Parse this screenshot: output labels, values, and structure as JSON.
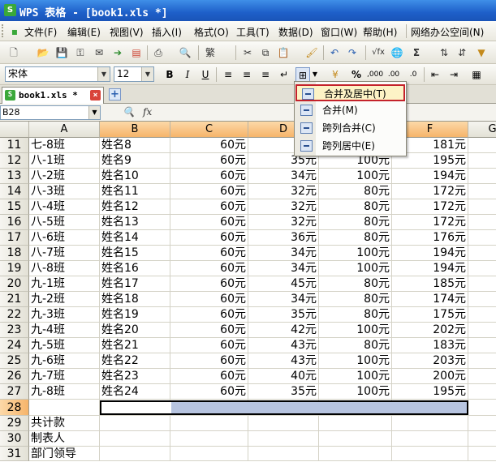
{
  "window": {
    "title": "WPS 表格 - [book1.xls *]",
    "logo": "S"
  },
  "menu": [
    "文件(F)",
    "编辑(E)",
    "视图(V)",
    "插入(I)",
    "格式(O)",
    "工具(T)",
    "数据(D)",
    "窗口(W)",
    "帮助(H)",
    "网络办公空间(N)"
  ],
  "format_toolbar": {
    "font_name": "宋体",
    "font_size": "12",
    "bold": "B",
    "italic": "I",
    "underline": "U",
    "percent": "%"
  },
  "tabs": [
    {
      "label": "book1.xls *",
      "close": "×"
    }
  ],
  "new_tab": "+",
  "formula_bar": {
    "cell_ref": "B28",
    "value": ""
  },
  "columns": [
    "A",
    "B",
    "C",
    "D",
    "E",
    "F",
    "G"
  ],
  "rows": [
    {
      "n": "11",
      "a": "七-8班",
      "b": "姓名8",
      "c": "60元",
      "d": "4",
      "e": "",
      "f": "181元"
    },
    {
      "n": "12",
      "a": "八-1班",
      "b": "姓名9",
      "c": "60元",
      "d": "35元",
      "e": "100元",
      "f": "195元"
    },
    {
      "n": "13",
      "a": "八-2班",
      "b": "姓名10",
      "c": "60元",
      "d": "34元",
      "e": "100元",
      "f": "194元"
    },
    {
      "n": "14",
      "a": "八-3班",
      "b": "姓名11",
      "c": "60元",
      "d": "32元",
      "e": "80元",
      "f": "172元"
    },
    {
      "n": "15",
      "a": "八-4班",
      "b": "姓名12",
      "c": "60元",
      "d": "32元",
      "e": "80元",
      "f": "172元"
    },
    {
      "n": "16",
      "a": "八-5班",
      "b": "姓名13",
      "c": "60元",
      "d": "32元",
      "e": "80元",
      "f": "172元"
    },
    {
      "n": "17",
      "a": "八-6班",
      "b": "姓名14",
      "c": "60元",
      "d": "36元",
      "e": "80元",
      "f": "176元"
    },
    {
      "n": "18",
      "a": "八-7班",
      "b": "姓名15",
      "c": "60元",
      "d": "34元",
      "e": "100元",
      "f": "194元"
    },
    {
      "n": "19",
      "a": "八-8班",
      "b": "姓名16",
      "c": "60元",
      "d": "34元",
      "e": "100元",
      "f": "194元"
    },
    {
      "n": "20",
      "a": "九-1班",
      "b": "姓名17",
      "c": "60元",
      "d": "45元",
      "e": "80元",
      "f": "185元"
    },
    {
      "n": "21",
      "a": "九-2班",
      "b": "姓名18",
      "c": "60元",
      "d": "34元",
      "e": "80元",
      "f": "174元"
    },
    {
      "n": "22",
      "a": "九-3班",
      "b": "姓名19",
      "c": "60元",
      "d": "35元",
      "e": "80元",
      "f": "175元"
    },
    {
      "n": "23",
      "a": "九-4班",
      "b": "姓名20",
      "c": "60元",
      "d": "42元",
      "e": "100元",
      "f": "202元"
    },
    {
      "n": "24",
      "a": "九-5班",
      "b": "姓名21",
      "c": "60元",
      "d": "43元",
      "e": "80元",
      "f": "183元"
    },
    {
      "n": "25",
      "a": "九-6班",
      "b": "姓名22",
      "c": "60元",
      "d": "43元",
      "e": "100元",
      "f": "203元"
    },
    {
      "n": "26",
      "a": "九-7班",
      "b": "姓名23",
      "c": "60元",
      "d": "40元",
      "e": "100元",
      "f": "200元"
    },
    {
      "n": "27",
      "a": "九-8班",
      "b": "姓名24",
      "c": "60元",
      "d": "35元",
      "e": "100元",
      "f": "195元"
    },
    {
      "n": "28",
      "a": "",
      "b": "",
      "c": "",
      "d": "",
      "e": "",
      "f": ""
    },
    {
      "n": "29",
      "a": "共计款",
      "b": "",
      "c": "",
      "d": "",
      "e": "",
      "f": ""
    },
    {
      "n": "30",
      "a": "制表人",
      "b": "",
      "c": "",
      "d": "",
      "e": "",
      "f": ""
    },
    {
      "n": "31",
      "a": "部门领导",
      "b": "",
      "c": "",
      "d": "",
      "e": "",
      "f": ""
    }
  ],
  "selected_row": "28",
  "merge_menu": [
    {
      "label": "合并及居中(T)",
      "icon": "merge-center-icon",
      "highlighted": true
    },
    {
      "label": "合并(M)",
      "icon": "merge-icon",
      "highlighted": false
    },
    {
      "label": "跨列合并(C)",
      "icon": "merge-across-icon",
      "highlighted": false
    },
    {
      "label": "跨列居中(E)",
      "icon": "center-across-icon",
      "highlighted": false
    }
  ],
  "colors": {
    "title_bar": "#1e5fc9",
    "selected_header": "#f6b46a",
    "selection_fill": "#b7c4e0",
    "menu_highlight_border": "#c4222a"
  }
}
